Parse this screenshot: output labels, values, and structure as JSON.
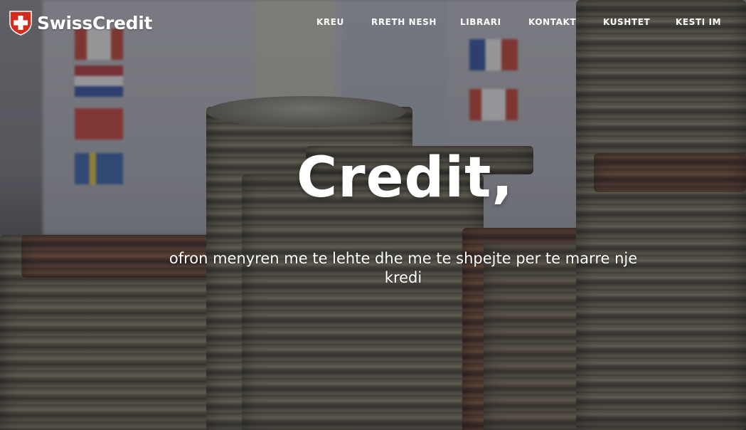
{
  "brand": {
    "name": "SwissCredit",
    "icon": "swiss-shield-icon"
  },
  "nav": {
    "items": [
      {
        "label": "KREU"
      },
      {
        "label": "RRETH NESH"
      },
      {
        "label": "LIBRARI"
      },
      {
        "label": "KONTAKT"
      },
      {
        "label": "KUSHTET"
      },
      {
        "label": "KESTI IM"
      }
    ]
  },
  "hero": {
    "headline": "Credit,",
    "subheadline": "ofron menyren me te lehte dhe me te shpejte per te marre nje kredi"
  },
  "colors": {
    "brand_red": "#d52b1e",
    "text": "#ffffff"
  }
}
